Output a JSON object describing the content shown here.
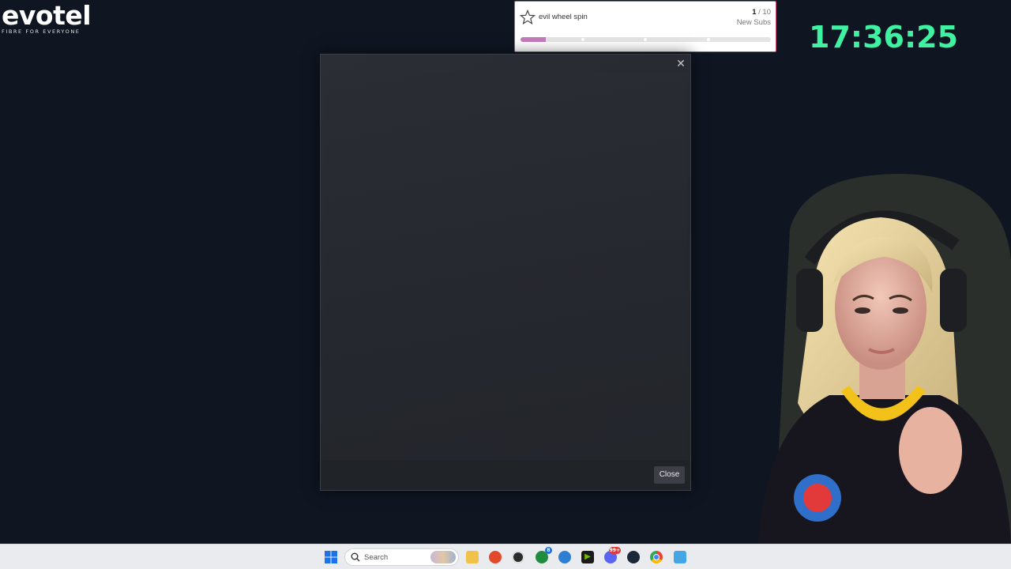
{
  "overlay": {
    "sponsor_logo": {
      "word": "evotel",
      "tagline": "FIBRE FOR EVERYONE"
    },
    "sub_goal": {
      "title": "evil wheel spin",
      "current": "1",
      "separator": " / ",
      "target": "10",
      "unit": "New Subs",
      "progress_fraction": 0.1,
      "colors": {
        "fill": "#c47aba",
        "border": "#d34a78"
      }
    },
    "clock": {
      "time": "17:36:25",
      "color": "#3ff2a2"
    }
  },
  "modal": {
    "close_icon": "close-icon",
    "close_button_label": "Close"
  },
  "taskbar": {
    "search_placeholder": "Search",
    "icons": [
      {
        "name": "windows-start-icon"
      },
      {
        "name": "file-explorer-icon"
      },
      {
        "name": "brave-browser-icon"
      },
      {
        "name": "obs-studio-icon"
      },
      {
        "name": "xbox-icon",
        "badge": "8"
      },
      {
        "name": "phone-link-icon"
      },
      {
        "name": "nvidia-icon"
      },
      {
        "name": "discord-icon",
        "badge": "99+"
      },
      {
        "name": "steam-icon"
      },
      {
        "name": "chrome-icon"
      },
      {
        "name": "notepad-icon"
      }
    ]
  }
}
